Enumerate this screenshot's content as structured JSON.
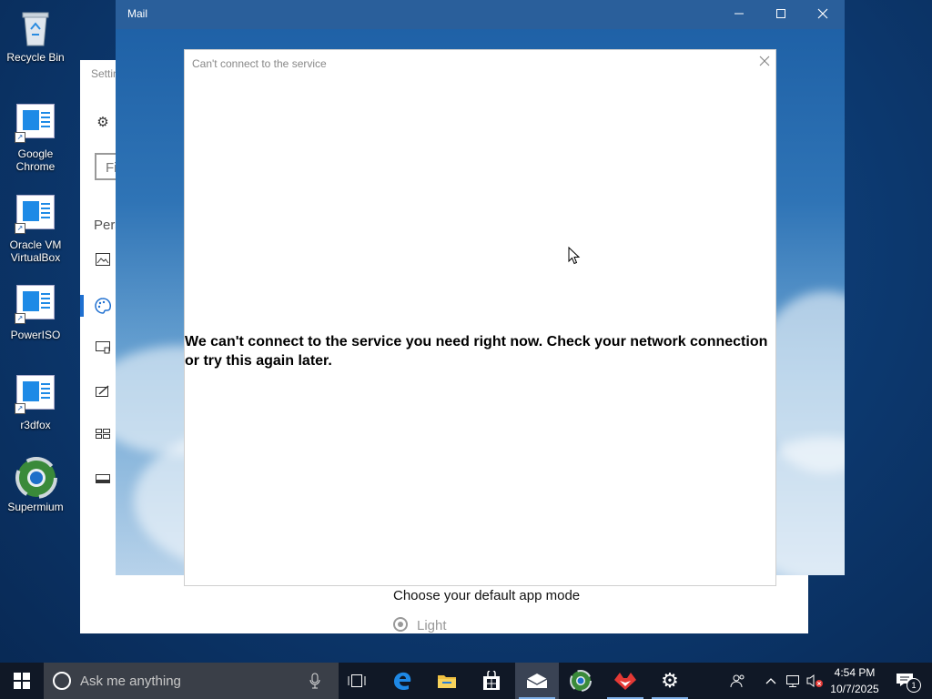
{
  "desktop": {
    "icons": [
      {
        "label": "Recycle Bin",
        "icon": "recycle-bin-icon"
      },
      {
        "label": "Google Chrome",
        "icon": "shortcut-icon"
      },
      {
        "label": "Oracle VM VirtualBox",
        "icon": "shortcut-icon"
      },
      {
        "label": "PowerISO",
        "icon": "shortcut-icon"
      },
      {
        "label": "r3dfox",
        "icon": "shortcut-icon"
      },
      {
        "label": "Supermium",
        "icon": "supermium-icon"
      }
    ]
  },
  "settings_window": {
    "title": "Settin",
    "search_text": "Fi",
    "section": "Pers",
    "mode_heading": "Choose your default app mode",
    "radio_light": "Light"
  },
  "mail_window": {
    "title": "Mail",
    "controls": [
      "minimize",
      "maximize",
      "close"
    ]
  },
  "dialog": {
    "title": "Can't connect to the service",
    "message": "We can't connect to the service you need right now. Check your network connection or try this again later."
  },
  "taskbar": {
    "search_placeholder": "Ask me anything",
    "apps": [
      "task-view-icon",
      "edge-icon",
      "file-explorer-icon",
      "store-icon",
      "mail-icon",
      "supermium-icon",
      "r3dfox-icon",
      "settings-icon"
    ],
    "clock_time": "4:54 PM",
    "clock_date": "10/7/2025",
    "notification_count": "1",
    "colors": {
      "taskbar": "#101826",
      "search": "#3a3f48",
      "accent": "#7fb0e8"
    }
  }
}
